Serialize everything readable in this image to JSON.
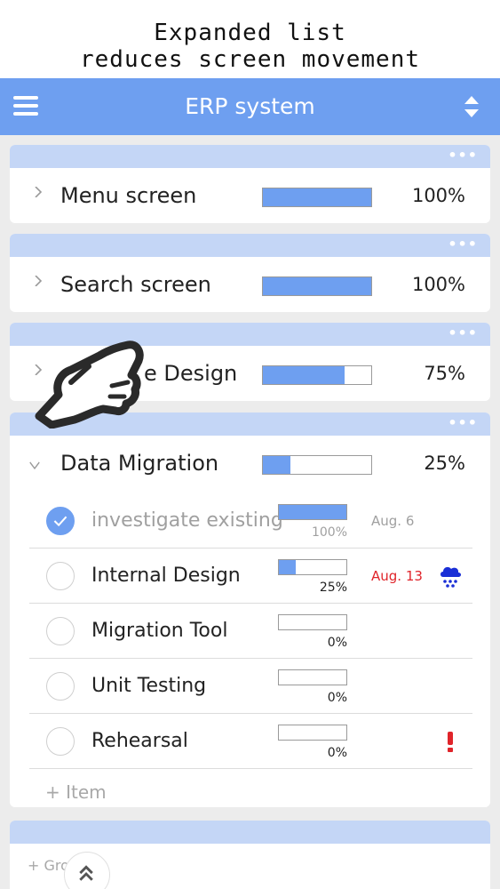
{
  "caption": {
    "line1": "Expanded list",
    "line2": "reduces screen movement"
  },
  "header": {
    "title": "ERP system",
    "menu_icon": "hamburger-menu-icon",
    "sort_icon": "sort-arrows-icon"
  },
  "groups": [
    {
      "name": "Menu screen",
      "progress": 1.0,
      "percent": "100%"
    },
    {
      "name": "Search screen",
      "progress": 1.0,
      "percent": "100%"
    },
    {
      "name": "e Design",
      "progress": 0.75,
      "percent": "75%"
    },
    {
      "name": "Data Migration",
      "progress": 0.25,
      "percent": "25%"
    }
  ],
  "tasks": [
    {
      "name": "investigate existing",
      "progress": 1.0,
      "percent": "100%",
      "date": "Aug. 6",
      "done": true
    },
    {
      "name": "Internal Design",
      "progress": 0.25,
      "percent": "25%",
      "date": "Aug. 13",
      "icon": "rain-cloud-icon"
    },
    {
      "name": "Migration Tool",
      "progress": 0.0,
      "percent": "0%"
    },
    {
      "name": "Unit Testing",
      "progress": 0.0,
      "percent": "0%"
    },
    {
      "name": "Rehearsal",
      "progress": 0.0,
      "percent": "0%",
      "icon": "exclamation-icon"
    }
  ],
  "add_item_label": "+ Item",
  "add_group_label": "+ Gro",
  "colors": {
    "accent": "#6e9ff0",
    "card_header": "#c4d6f6",
    "late_date": "#e0242a",
    "alert": "#e0242a",
    "weather_icon": "#1a2fd6"
  }
}
